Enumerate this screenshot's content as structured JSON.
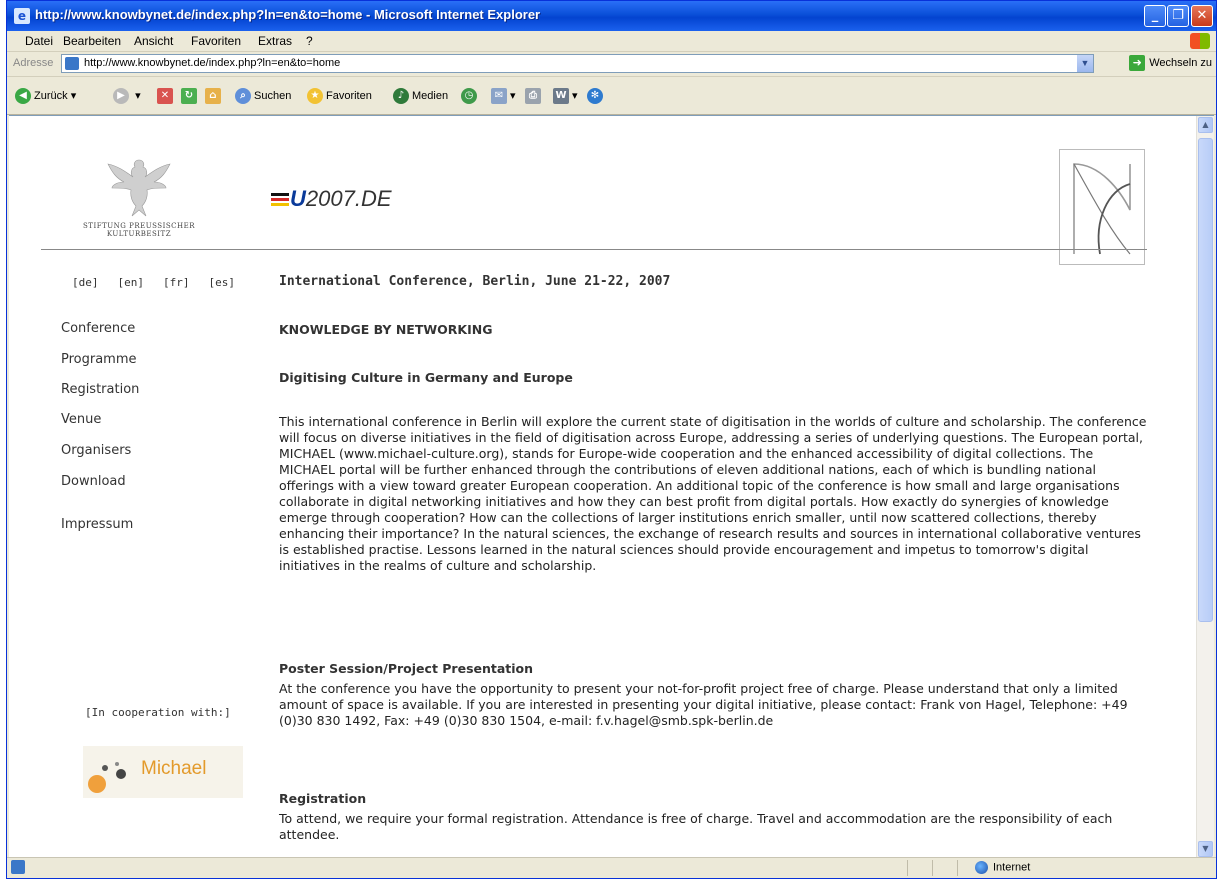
{
  "window": {
    "title": "http://www.knowbynet.de/index.php?ln=en&to=home - Microsoft Internet Explorer"
  },
  "menu": [
    "Datei",
    "Bearbeiten",
    "Ansicht",
    "Favoriten",
    "Extras",
    "?"
  ],
  "address": {
    "label": "Adresse",
    "url": "http://www.knowbynet.de/index.php?ln=en&to=home",
    "go_label": "Wechseln zu"
  },
  "toolbar": {
    "back": "Zurück",
    "search": "Suchen",
    "favorites": "Favoriten",
    "media": "Medien"
  },
  "page": {
    "logo_caption_1": "STIFTUNG PREUSSISCHER",
    "logo_caption_2": "KULTURBESITZ",
    "eu_logo_text": "2007.DE",
    "languages": [
      "[de]",
      "[en]",
      "[fr]",
      "[es]"
    ],
    "nav": [
      "Conference",
      "Programme",
      "Registration",
      "Venue",
      "Organisers",
      "Download",
      "Impressum"
    ],
    "conference_title": "International Conference, Berlin, June 21-22, 2007",
    "heading_main": "KNOWLEDGE BY NETWORKING",
    "heading_sub": "Digitising Culture in Germany and Europe",
    "intro_text": "This international conference in Berlin will explore the current state of digitisation in the worlds of culture and scholarship. The conference will focus on diverse initiatives in the field of digitisation across Europe, addressing a series of underlying questions. The European portal, MICHAEL (www.michael-culture.org), stands for Europe-wide cooperation and the enhanced accessibility of digital collections. The MICHAEL portal will be further enhanced through the contributions of eleven additional nations, each of which is bundling national offerings with a view toward greater European cooperation. An additional topic of the conference is how small and large organisations collaborate in digital networking initiatives and how they can best profit from digital portals. How exactly do synergies of knowledge emerge through cooperation? How can the collections of larger institutions enrich smaller, until now scattered collections, thereby enhancing their importance? In the natural sciences, the exchange of research results and sources in international collaborative ventures is established practise. Lessons learned in the natural sciences should provide encouragement and impetus to tomorrow's digital initiatives in the realms of culture and scholarship.",
    "poster_heading": "Poster Session/Project Presentation",
    "poster_text": "At the conference you have the opportunity to present your not-for-profit project free of charge. Please understand that only a limited amount of space is available. If you are interested in presenting your digital initiative, please contact: Frank von Hagel, Telephone: +49 (0)30 830 1492, Fax: +49 (0)30 830 1504, e-mail: f.v.hagel@smb.spk-berlin.de",
    "registration_heading": "Registration",
    "registration_text": "To attend, we require your formal registration. Attendance is free of charge. Travel and accommodation are the responsibility of each attendee.",
    "cooperation_label": "[In cooperation with:]",
    "partner_logo_text": "Michael"
  },
  "status": {
    "zone": "Internet"
  },
  "colors": {
    "title_bar": "#0a4fd8",
    "michael_orange": "#e39a2b"
  }
}
